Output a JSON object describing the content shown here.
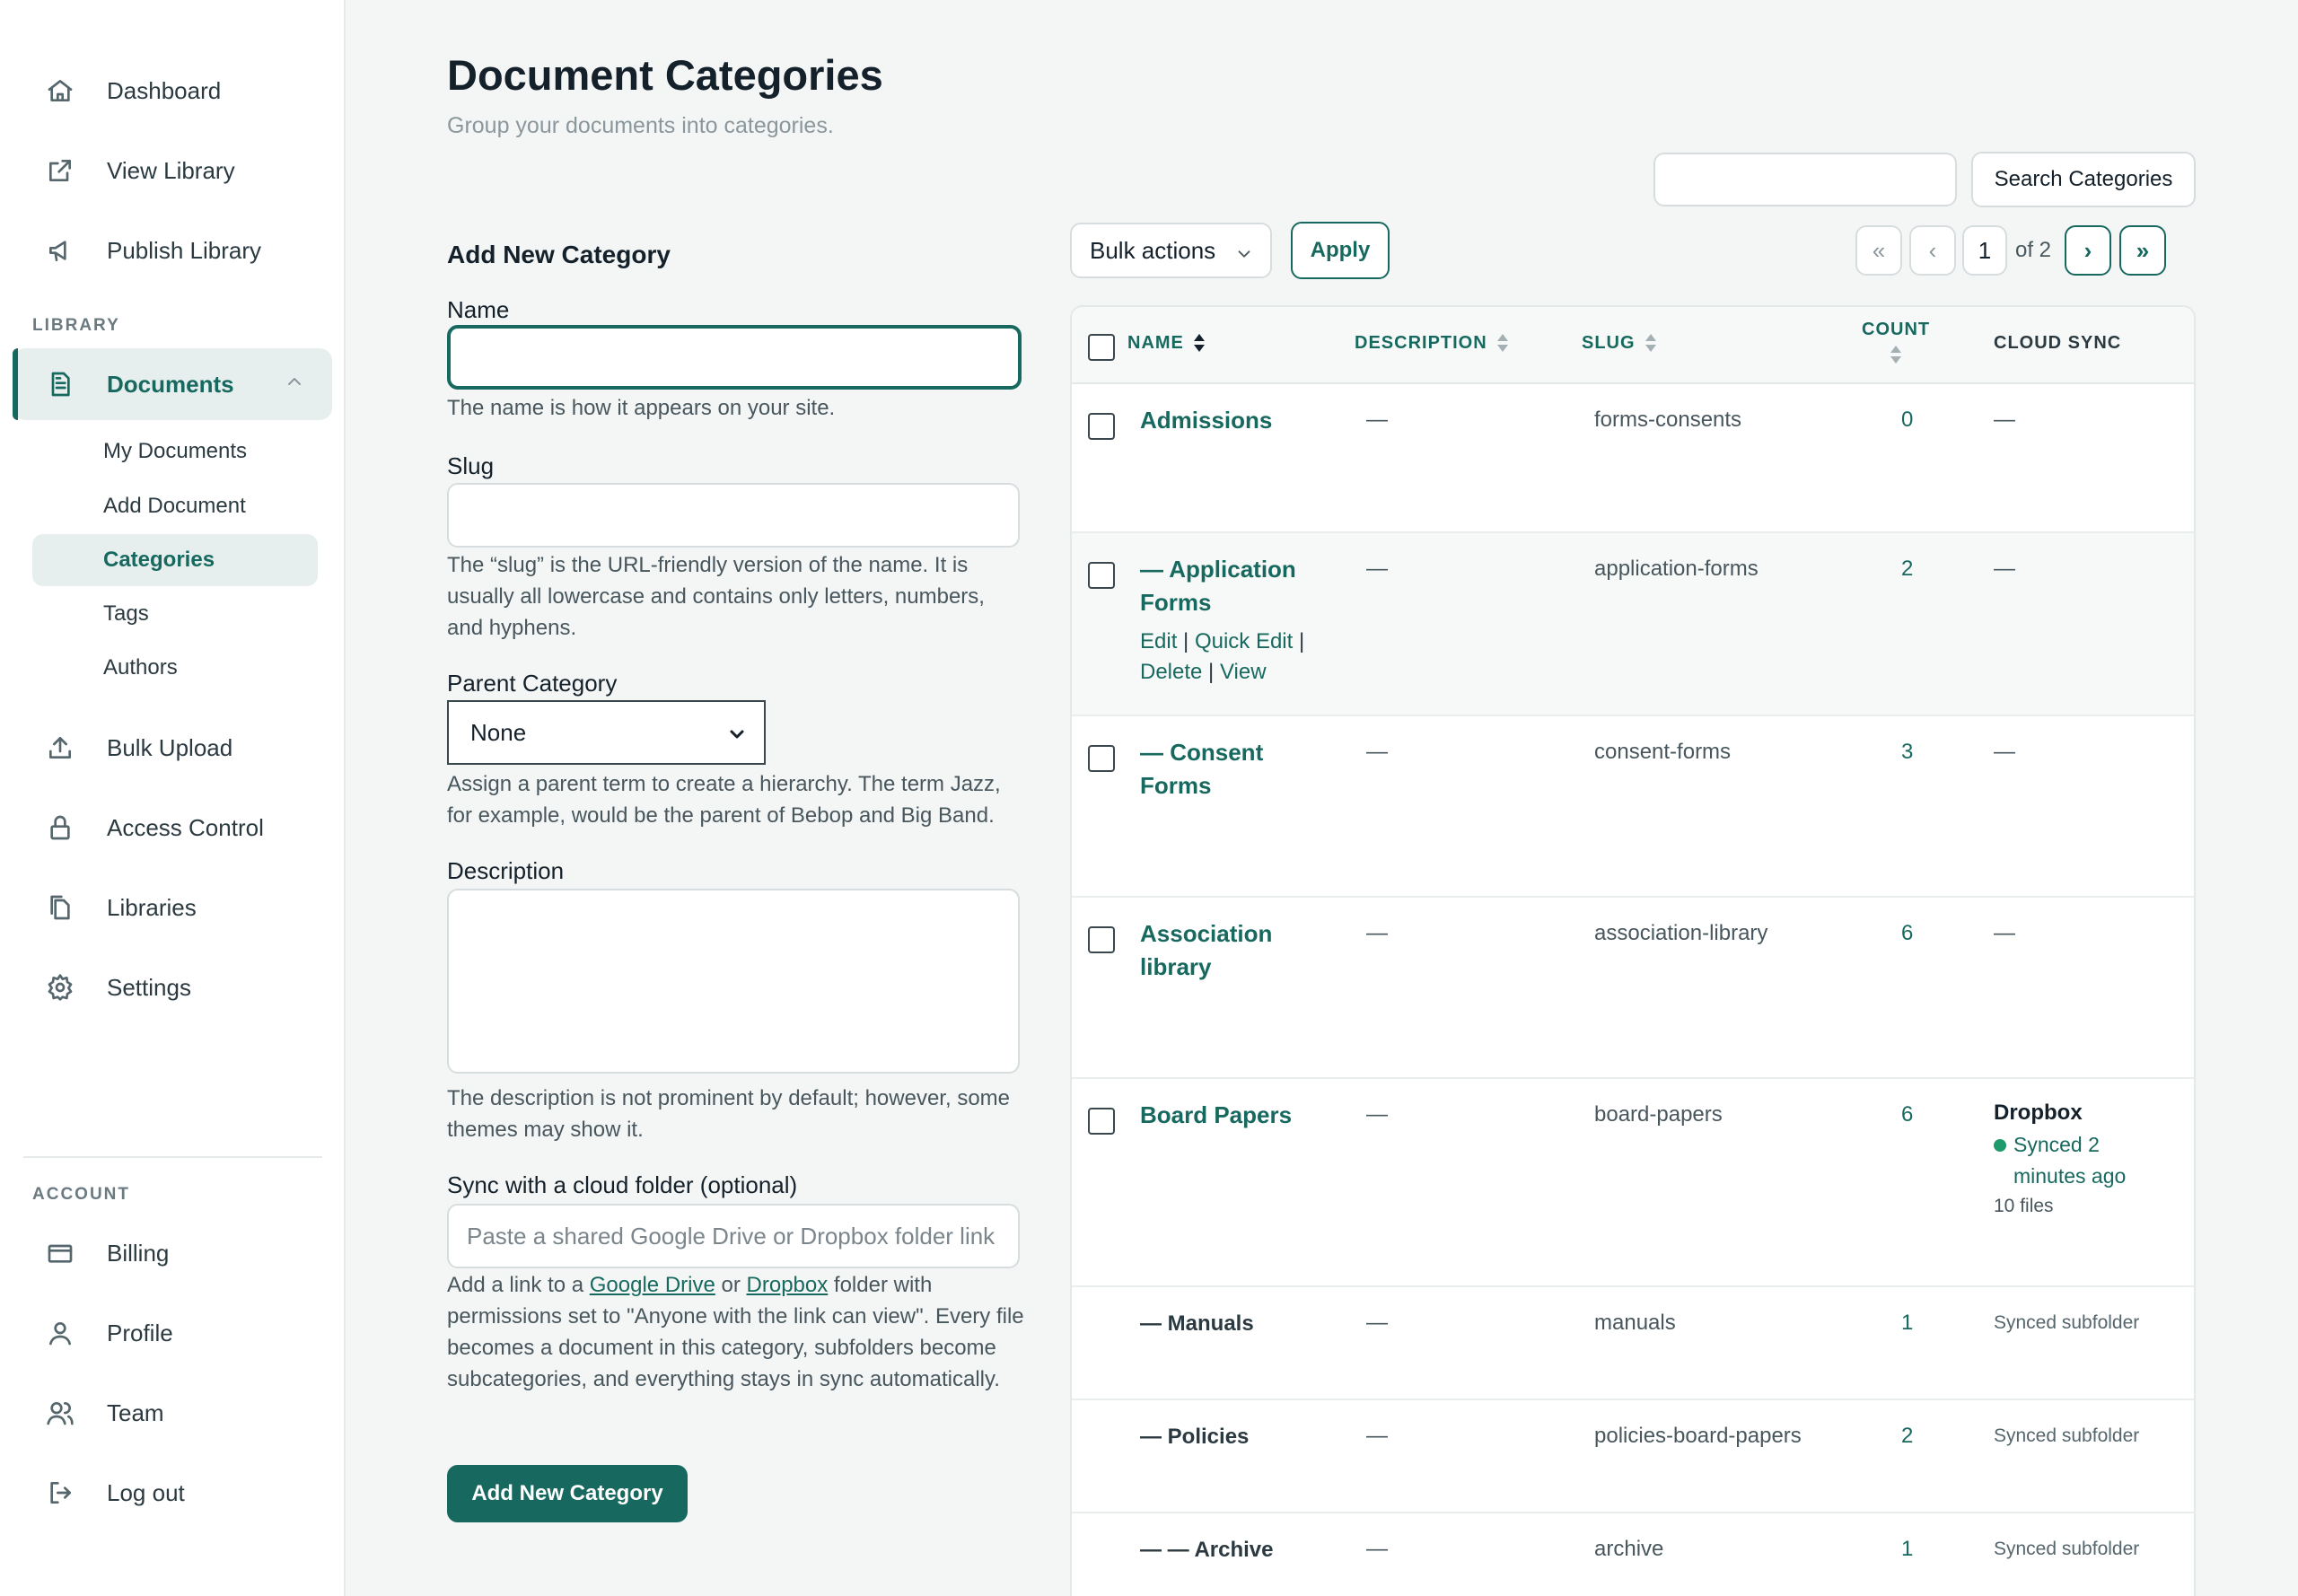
{
  "sidebar": {
    "top_items": [
      {
        "label": "Dashboard",
        "icon": "home-icon"
      },
      {
        "label": "View Library",
        "icon": "external-link-icon"
      },
      {
        "label": "Publish Library",
        "icon": "megaphone-icon"
      }
    ],
    "library_section": "LIBRARY",
    "documents": {
      "label": "Documents",
      "icon": "document-icon"
    },
    "sub_items": [
      "My Documents",
      "Add Document",
      "Categories",
      "Tags",
      "Authors"
    ],
    "more_items": [
      {
        "label": "Bulk Upload",
        "icon": "upload-icon"
      },
      {
        "label": "Access Control",
        "icon": "lock-icon"
      },
      {
        "label": "Libraries",
        "icon": "files-icon"
      },
      {
        "label": "Settings",
        "icon": "gear-icon"
      }
    ],
    "account_section": "ACCOUNT",
    "account_items": [
      {
        "label": "Billing",
        "icon": "credit-card-icon"
      },
      {
        "label": "Profile",
        "icon": "user-icon"
      },
      {
        "label": "Team",
        "icon": "users-icon"
      },
      {
        "label": "Log out",
        "icon": "logout-icon"
      }
    ]
  },
  "header": {
    "title": "Document Categories",
    "subtitle": "Group your documents into categories."
  },
  "form": {
    "heading": "Add New Category",
    "name_label": "Name",
    "name_value": "",
    "name_help": "The name is how it appears on your site.",
    "slug_label": "Slug",
    "slug_value": "",
    "slug_help": "The “slug” is the URL-friendly version of the name. It is usually all lowercase and contains only letters, numbers, and hyphens.",
    "parent_label": "Parent Category",
    "parent_selected": "None",
    "parent_help": "Assign a parent term to create a hierarchy. The term Jazz, for example, would be the parent of Bebop and Big Band.",
    "description_label": "Description",
    "description_help": "The description is not prominent by default; however, some themes may show it.",
    "sync_label": "Sync with a cloud folder (optional)",
    "sync_placeholder": "Paste a shared Google Drive or Dropbox folder link",
    "sync_help_pre": "Add a link to a ",
    "sync_help_gdrive": "Google Drive",
    "sync_help_or": " or ",
    "sync_help_dropbox": "Dropbox",
    "sync_help_post": " folder with permissions set to \"Anyone with the link can view\". Every file becomes a document in this category, subfolders become subcategories, and everything stays in sync automatically.",
    "submit_label": "Add New Category"
  },
  "toolbar": {
    "search_value": "",
    "search_button": "Search Categories",
    "bulk_label": "Bulk actions",
    "apply_label": "Apply",
    "first_page": "«",
    "prev_page": "‹",
    "current_page": "1",
    "of_pages": "of 2",
    "next_page": "›",
    "last_page": "»"
  },
  "table": {
    "columns": {
      "name": "NAME",
      "description": "DESCRIPTION",
      "slug": "SLUG",
      "count": "COUNT",
      "cloud_sync": "CLOUD SYNC"
    },
    "rows": [
      {
        "name": "Admissions",
        "description": "—",
        "slug": "forms-consents",
        "count": "0",
        "sync": "—"
      },
      {
        "name_line1": "— Application",
        "name_line2": "Forms",
        "description": "—",
        "slug": "application-forms",
        "count": "2",
        "sync": "—",
        "actions": {
          "edit": "Edit",
          "quick_edit": "Quick Edit",
          "delete": "Delete",
          "view": "View"
        }
      },
      {
        "name_line1": "— Consent",
        "name_line2": "Forms",
        "description": "—",
        "slug": "consent-forms",
        "count": "3",
        "sync": "—"
      },
      {
        "name_line1": "Association",
        "name_line2": "library",
        "description": "—",
        "slug": "association-library",
        "count": "6",
        "sync": "—"
      },
      {
        "name": "Board Papers",
        "description": "—",
        "slug": "board-papers",
        "count": "6",
        "sync_provider": "Dropbox",
        "sync_status_line1": "Synced 2",
        "sync_status_line2": "minutes ago",
        "sync_files": "10 files"
      },
      {
        "name": "— Manuals",
        "description": "—",
        "slug": "manuals",
        "count": "1",
        "sync": "Synced subfolder"
      },
      {
        "name": "— Policies",
        "description": "—",
        "slug": "policies-board-papers",
        "count": "2",
        "sync": "Synced subfolder"
      },
      {
        "name": "— — Archive",
        "description": "—",
        "slug": "archive",
        "count": "1",
        "sync": "Synced subfolder"
      }
    ]
  },
  "colors": {
    "accent": "#17695f",
    "active_bg": "#e6efee",
    "synced_dot": "#1f9a6b"
  }
}
